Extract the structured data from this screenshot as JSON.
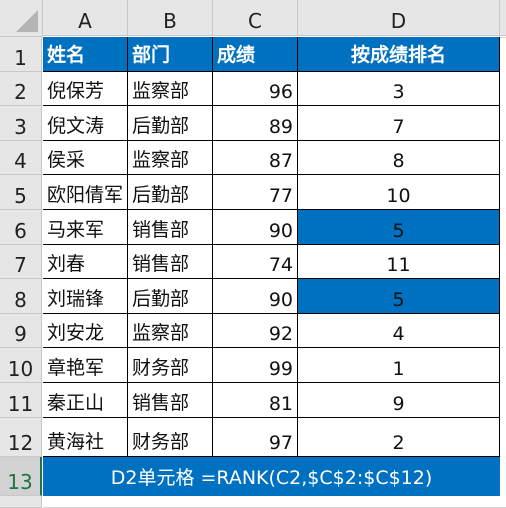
{
  "columns": [
    "A",
    "B",
    "C",
    "D"
  ],
  "row_numbers": [
    "1",
    "2",
    "3",
    "4",
    "5",
    "6",
    "7",
    "8",
    "9",
    "10",
    "11",
    "12",
    "13"
  ],
  "header": {
    "name": "姓名",
    "dept": "部门",
    "score": "成绩",
    "rank": "按成绩排名"
  },
  "rows": [
    {
      "name": "倪保芳",
      "dept": "监察部",
      "score": "96",
      "rank": "3",
      "highlight": false
    },
    {
      "name": "倪文涛",
      "dept": "后勤部",
      "score": "89",
      "rank": "7",
      "highlight": false
    },
    {
      "name": "侯采",
      "dept": "监察部",
      "score": "87",
      "rank": "8",
      "highlight": false
    },
    {
      "name": "欧阳倩军",
      "dept": "后勤部",
      "score": "77",
      "rank": "10",
      "highlight": false
    },
    {
      "name": "马来军",
      "dept": "销售部",
      "score": "90",
      "rank": "5",
      "highlight": true
    },
    {
      "name": "刘春",
      "dept": "销售部",
      "score": "74",
      "rank": "11",
      "highlight": false
    },
    {
      "name": "刘瑞锋",
      "dept": "后勤部",
      "score": "90",
      "rank": "5",
      "highlight": true
    },
    {
      "name": "刘安龙",
      "dept": "监察部",
      "score": "92",
      "rank": "4",
      "highlight": false
    },
    {
      "name": "章艳军",
      "dept": "财务部",
      "score": "99",
      "rank": "1",
      "highlight": false
    },
    {
      "name": "秦正山",
      "dept": "销售部",
      "score": "81",
      "rank": "9",
      "highlight": false
    },
    {
      "name": "黄海社",
      "dept": "财务部",
      "score": "97",
      "rank": "2",
      "highlight": false
    }
  ],
  "formula_note": "D2单元格 =RANK(C2,$C$2:$C$12)",
  "colors": {
    "header_fill": "#0070c0",
    "highlight_fill": "#0070c0",
    "selected_row_header": "#217346"
  }
}
